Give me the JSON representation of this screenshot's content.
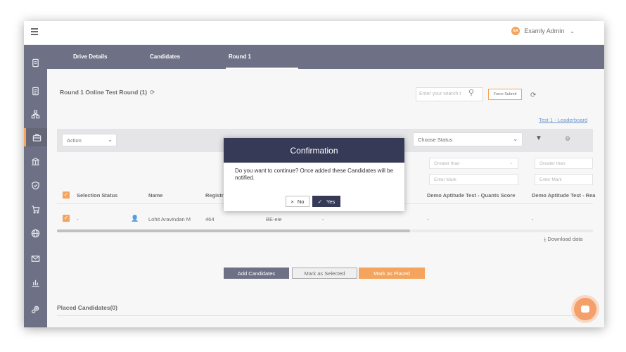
{
  "header": {
    "menu_icon": "hamburger-icon",
    "user_initials": "EA",
    "user_name": "Examly Admin"
  },
  "tabs": [
    {
      "label": "Drive Details",
      "active": false
    },
    {
      "label": "Candidates",
      "active": false
    },
    {
      "label": "Round 1",
      "active": true
    }
  ],
  "round": {
    "title": "Round 1 Online Test Round (1)",
    "search_placeholder": "Enter your search t",
    "force_submit_label": "Force Submit",
    "leaderboard_link": "Test 1 - Leaderboard"
  },
  "filters": {
    "action_label": "Action",
    "status_select": "Choose Status",
    "greater_than_1": "Greater than",
    "greater_than_2": "Greater than",
    "enter_mark_1": "Enter Mark",
    "enter_mark_2": "Enter Mark"
  },
  "table": {
    "headers": {
      "selection_status": "Selection Status",
      "name": "Name",
      "registration": "Registr",
      "quants": "Demo Aptitude Test - Quants Score",
      "reasoning": "Demo Aptitude Test - Rea"
    },
    "rows": [
      {
        "status": "-",
        "name": "Lohit Aravindan M",
        "reg": "464",
        "dept": "BE-eie",
        "col5": "-",
        "quants": "-",
        "reasoning": "-"
      }
    ],
    "download_label": "Download data"
  },
  "actions": {
    "add_candidates": "Add Candidates",
    "mark_selected": "Mark as Selected",
    "mark_placed": "Mark as Placed"
  },
  "placed": {
    "title": "Placed Candidates(0)"
  },
  "dialog": {
    "title": "Confirmation",
    "message": "Do you want to continue? Once added these Candidates will be notified.",
    "no_label": "No",
    "yes_label": "Yes"
  },
  "colors": {
    "navy": "#363a56",
    "accent": "#f0821e",
    "link": "#2f6fba"
  }
}
